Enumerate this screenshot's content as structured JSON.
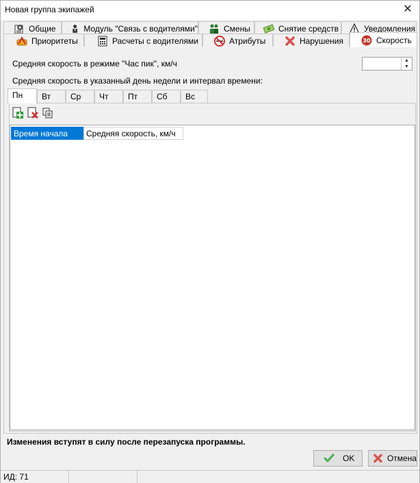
{
  "window": {
    "title": "Новая группа экипажей"
  },
  "tabs_row1": [
    {
      "label": "Общие",
      "icon": "settings-page-icon"
    },
    {
      "label": "Модуль \"Связь с водителями\"",
      "icon": "driver-icon"
    },
    {
      "label": "Смены",
      "icon": "shifts-icon"
    },
    {
      "label": "Снятие средств",
      "icon": "money-icon"
    },
    {
      "label": "Уведомления",
      "icon": "warning-icon"
    }
  ],
  "tabs_row2": [
    {
      "label": "Приоритеты",
      "icon": "priority-icon"
    },
    {
      "label": "Расчеты с водителями",
      "icon": "calculator-icon"
    },
    {
      "label": "Атрибуты",
      "icon": "no-smoking-icon"
    },
    {
      "label": "Нарушения",
      "icon": "red-x-icon"
    },
    {
      "label": "Скорость",
      "icon": "speed-limit-icon",
      "sign_text": "30",
      "active": true
    }
  ],
  "speed": {
    "rush_hour_label": "Средняя скорость в режиме \"Час пик\", км/ч",
    "rush_hour_value": "",
    "schedule_label": "Средняя скорость в указанный день недели и интервал времени:"
  },
  "days": [
    {
      "label": "Пн",
      "active": true
    },
    {
      "label": "Вт"
    },
    {
      "label": "Ср"
    },
    {
      "label": "Чт"
    },
    {
      "label": "Пт"
    },
    {
      "label": "Сб"
    },
    {
      "label": "Вс"
    }
  ],
  "toolbar": {
    "add_icon": "add-row-icon",
    "delete_icon": "delete-row-icon",
    "copy_icon": "copy-icon"
  },
  "grid": {
    "columns": [
      "Время начала",
      "Средняя скорость, км/ч"
    ]
  },
  "notice": "Изменения вступят в силу после перезапуска программы.",
  "buttons": {
    "ok": "OK",
    "cancel": "Отмена"
  },
  "status": {
    "id_text": "ИД: 71"
  },
  "colors": {
    "selection": "#0078d7",
    "speed_sign": "#c0392b",
    "ok_check": "#4caf50",
    "cancel_x": "#d9534f"
  }
}
